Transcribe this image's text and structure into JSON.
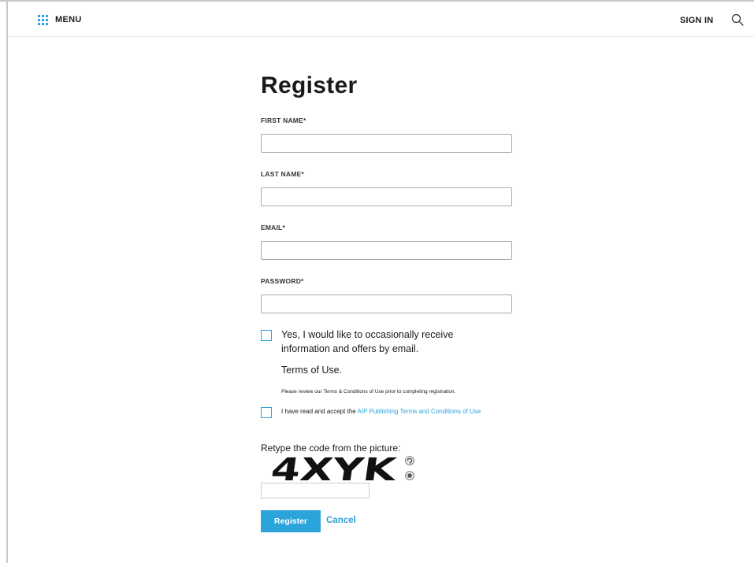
{
  "header": {
    "menu_label": "MENU",
    "menu_icon": "grid-icon",
    "signin_label": "SIGN IN",
    "search_icon": "search-icon"
  },
  "form": {
    "title": "Register",
    "fields": [
      {
        "label": "FIRST NAME*",
        "value": ""
      },
      {
        "label": "LAST NAME*",
        "value": ""
      },
      {
        "label": "EMAIL*",
        "value": ""
      },
      {
        "label": "PASSWORD*",
        "value": ""
      }
    ],
    "optin_label": "Yes, I would like to occasionally receive information and offers by email.",
    "terms_heading": "Terms of Use.",
    "terms_note": "Please review our Terms & Conditions of Use prior to completing registration.",
    "accept_prefix": "I have read and accept the ",
    "accept_link": "AIP Publishing Terms and Conditions of Use",
    "captcha_label": "Retype the code from the picture:",
    "captcha_code": "4XYK",
    "captcha_refresh_icon": "refresh-icon",
    "captcha_audio_icon": "audio-icon",
    "captcha_value": "",
    "register_label": "Register",
    "cancel_label": "Cancel"
  },
  "colors": {
    "accent": "#2ba3db",
    "text": "#1a1a1a",
    "border": "#a9a9a9"
  }
}
